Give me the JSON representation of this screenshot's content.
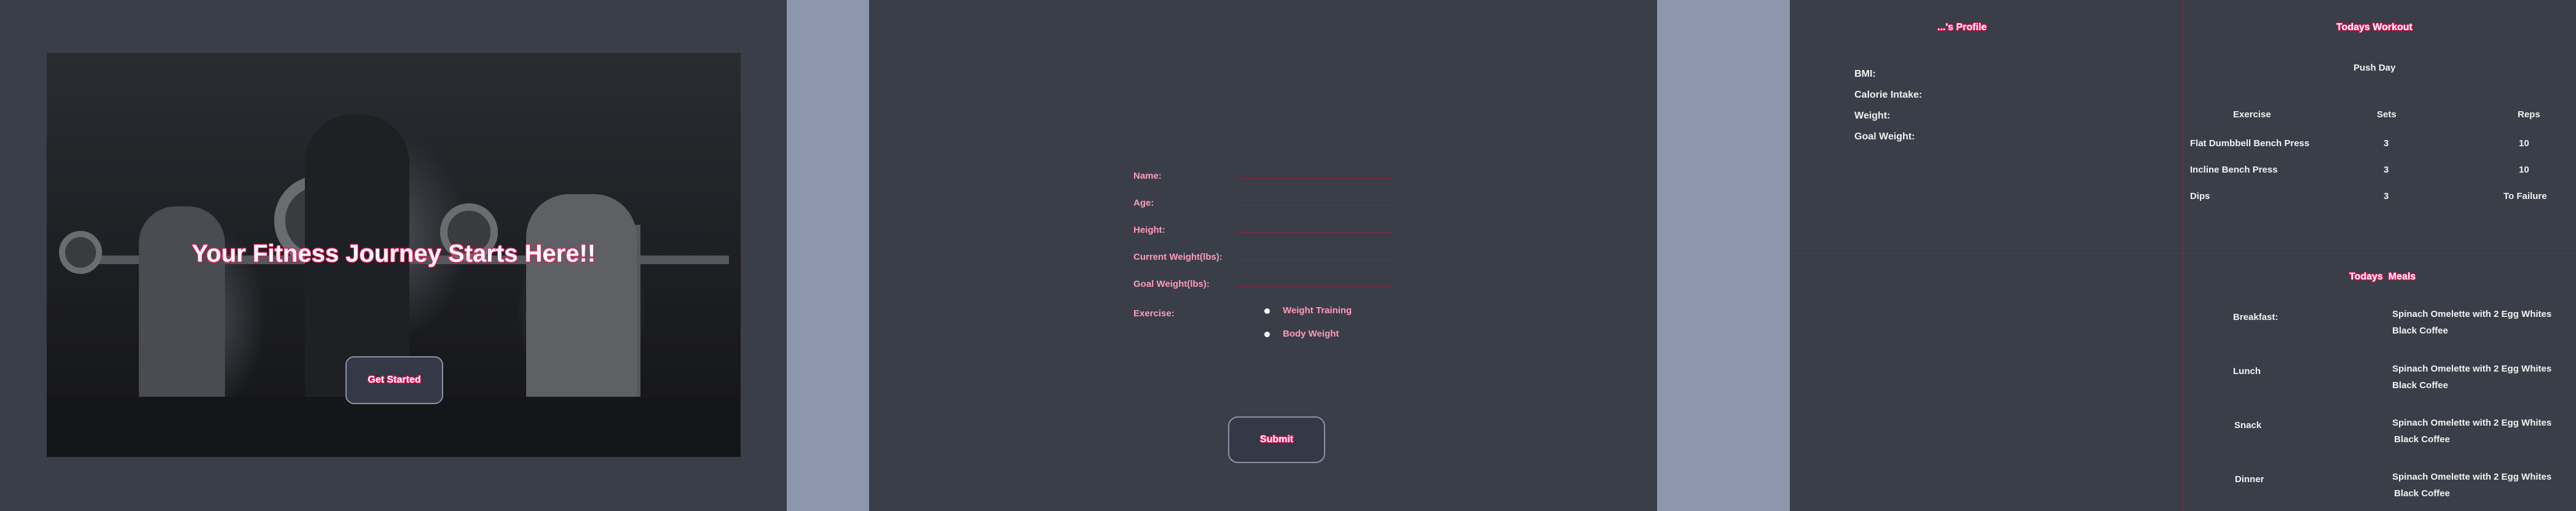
{
  "landing": {
    "title": "Your Fitness Journey Starts Here!!",
    "cta_label": "Get Started"
  },
  "form": {
    "fields": [
      {
        "label": "Name:"
      },
      {
        "label": "Age:"
      },
      {
        "label": "Height:"
      },
      {
        "label": "Current Weight(lbs):"
      },
      {
        "label": "Goal Weight(lbs):"
      }
    ],
    "exercise_label": "Exercise:",
    "exercise_options": [
      "Weight Training",
      "Body Weight"
    ],
    "submit_label": "Submit"
  },
  "dashboard": {
    "profile": {
      "title": "...'s Profile",
      "stats": [
        "BMI:",
        "Calorie Intake:",
        "Weight:",
        "Goal Weight:"
      ]
    },
    "workout": {
      "title": "Todays Workout",
      "day": "Push Day",
      "columns": [
        "Exercise",
        "Sets",
        "Reps"
      ],
      "rows": [
        [
          "Flat Dumbbell Bench Press",
          "3",
          "10"
        ],
        [
          "Incline Bench Press",
          "3",
          "10"
        ],
        [
          "Dips",
          "3",
          "To Failure"
        ]
      ]
    },
    "meals": {
      "title": "Todays  Meals",
      "items": [
        {
          "meal": "Breakfast:",
          "line1": "Spinach Omelette with 2 Egg Whites",
          "line2": "Black Coffee"
        },
        {
          "meal": "Lunch",
          "line1": "Spinach Omelette with 2 Egg Whites",
          "line2": "Black Coffee"
        },
        {
          "meal": "Snack",
          "line1": "Spinach Omelette with 2 Egg Whites",
          "line2": "Black Coffee"
        },
        {
          "meal": "Dinner",
          "line1": "Spinach Omelette with 2 Egg Whites",
          "line2": "Black Coffee"
        }
      ]
    }
  },
  "colors": {
    "background": "#3a3e48",
    "separator": "#8c97ae",
    "accent": "#ff2d6d",
    "divider": "#8d2440"
  }
}
